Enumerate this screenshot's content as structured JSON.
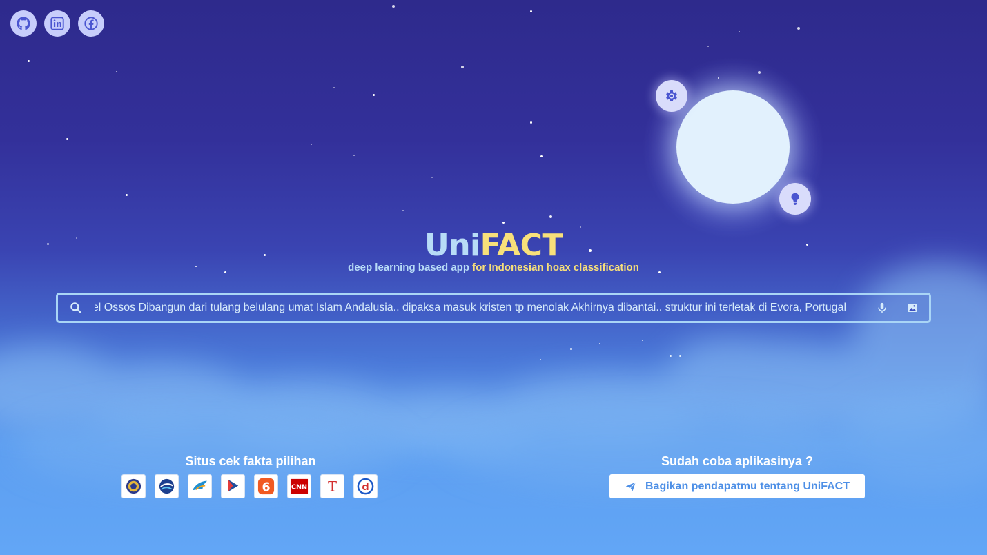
{
  "colors": {
    "title_primary": "#b8dcf7",
    "title_accent": "#f8e07a",
    "search_border": "#a9d5f6",
    "button_text": "#4d8fe6",
    "moon": "#e2f1fd"
  },
  "social": [
    {
      "icon": "github-icon"
    },
    {
      "icon": "linkedin-icon"
    },
    {
      "icon": "facebook-icon"
    }
  ],
  "orbs": {
    "settings_icon": "gear-icon",
    "idea_icon": "lightbulb-icon"
  },
  "brand": {
    "title_part1": "Uni",
    "title_part2": "FACT",
    "subtitle_part1": "deep learning based app ",
    "subtitle_part2": "for Indonesian hoax classification"
  },
  "search": {
    "value": "Kapel Ossos  Dibangun dari tulang belulang umat Islam Andalusia.. dipaksa masuk kristen tp menolak Akhirnya dibantai.. struktur ini terletak di Evora, Portugal",
    "search_icon": "search-icon",
    "mic_icon": "microphone-icon",
    "image_icon": "image-icon"
  },
  "fact_sites": {
    "title": "Situs cek fakta pilihan",
    "logos": [
      {
        "icon": "emblem-logo"
      },
      {
        "icon": "kominfo-logo"
      },
      {
        "icon": "bird-logo"
      },
      {
        "icon": "play-logo"
      },
      {
        "text": "6"
      },
      {
        "text": "CNN"
      },
      {
        "text": "T"
      },
      {
        "text": "d"
      }
    ]
  },
  "feedback": {
    "title": "Sudah coba aplikasinya ?",
    "button_label": "Bagikan pendapatmu tentang UniFACT",
    "button_icon": "send-icon"
  }
}
